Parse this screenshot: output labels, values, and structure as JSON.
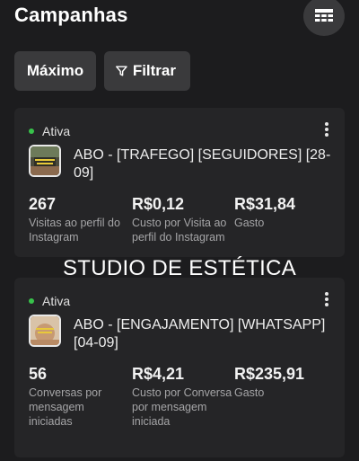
{
  "header": {
    "title": "Campanhas",
    "table_icon": "table-icon"
  },
  "actions": {
    "max_label": "Máximo",
    "filter_label": "Filtrar",
    "filter_icon": "filter-icon"
  },
  "overlay_text": "STUDIO DE ESTÉTICA",
  "colors": {
    "background": "#1c1c1e",
    "card": "#252527",
    "button": "#3a3a3c",
    "active": "#38c24b"
  },
  "campaigns": [
    {
      "status": "Ativa",
      "name": "ABO - [TRAFEGO] [SEGUIDORES] [28-09]",
      "metrics": [
        {
          "value": "267",
          "label": "Visitas ao perfil do Instagram"
        },
        {
          "value": "R$0,12",
          "label": "Custo por Visita ao perfil do Instagram"
        },
        {
          "value": "R$31,84",
          "label": "Gasto"
        }
      ]
    },
    {
      "status": "Ativa",
      "name": "ABO - [ENGAJAMENTO] [WHATSAPP] [04-09]",
      "metrics": [
        {
          "value": "56",
          "label": "Conversas por mensagem iniciadas"
        },
        {
          "value": "R$4,21",
          "label": "Custo por Conversa por mensagem iniciada"
        },
        {
          "value": "R$235,91",
          "label": "Gasto"
        }
      ]
    }
  ]
}
